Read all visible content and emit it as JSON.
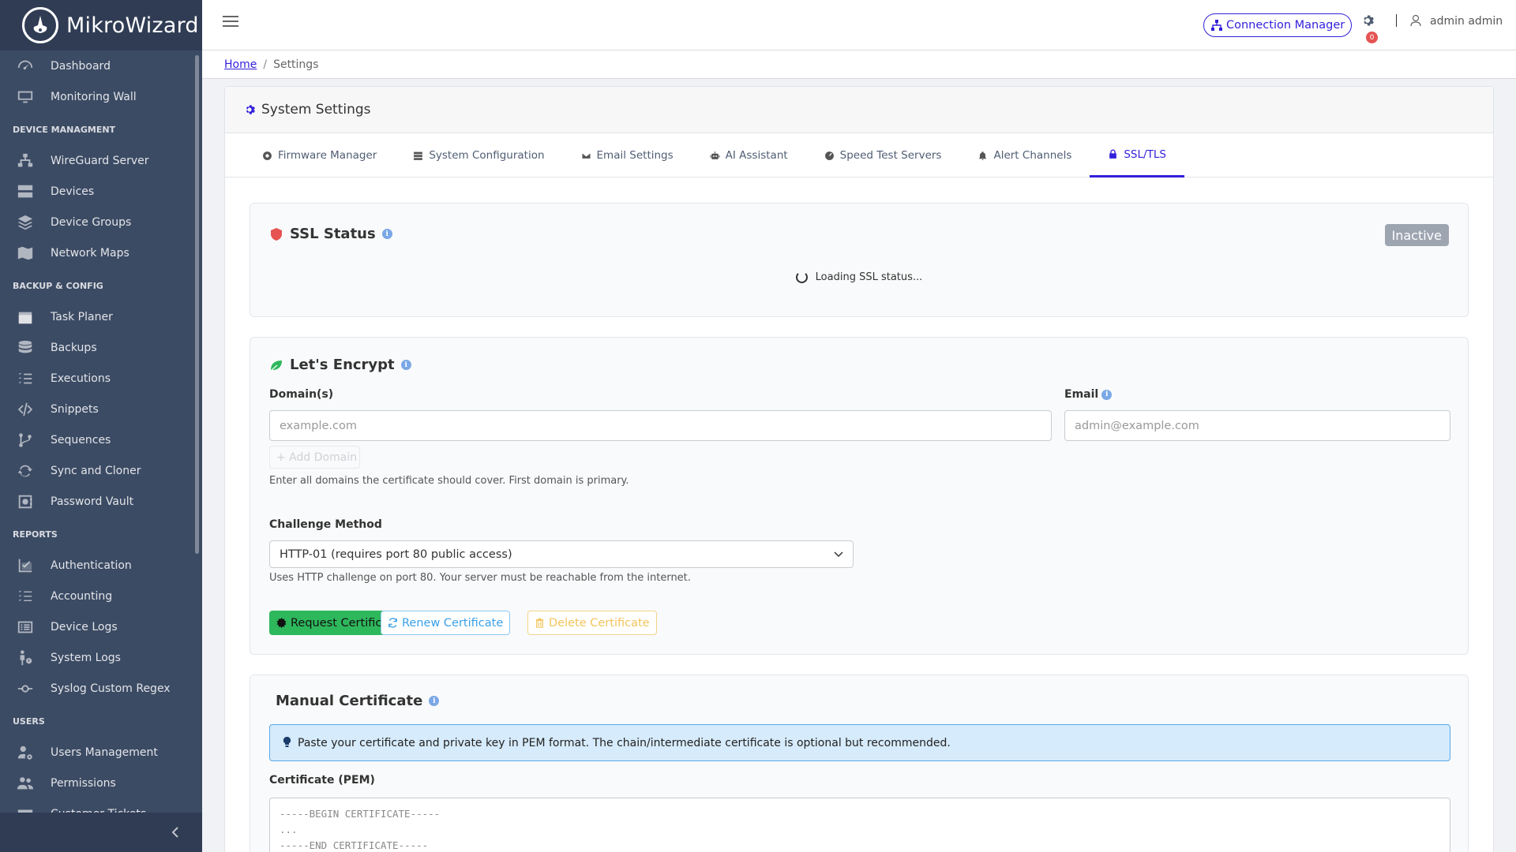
{
  "brand": {
    "name": "MikroWizard"
  },
  "sidebar": {
    "items": [
      {
        "type": "item",
        "label": "Dashboard",
        "icon": "speedometer-icon"
      },
      {
        "type": "item",
        "label": "Monitoring Wall",
        "icon": "monitor-icon"
      },
      {
        "type": "title",
        "label": "DEVICE MANAGMENT"
      },
      {
        "type": "item",
        "label": "WireGuard Server",
        "icon": "network-icon"
      },
      {
        "type": "item",
        "label": "Devices",
        "icon": "server-icon"
      },
      {
        "type": "item",
        "label": "Device Groups",
        "icon": "layers-icon"
      },
      {
        "type": "item",
        "label": "Network Maps",
        "icon": "map-icon"
      },
      {
        "type": "title",
        "label": "BACKUP & CONFIG"
      },
      {
        "type": "item",
        "label": "Task Planer",
        "icon": "calendar-icon"
      },
      {
        "type": "item",
        "label": "Backups",
        "icon": "database-icon"
      },
      {
        "type": "item",
        "label": "Executions",
        "icon": "list-check-icon"
      },
      {
        "type": "item",
        "label": "Snippets",
        "icon": "code-icon"
      },
      {
        "type": "item",
        "label": "Sequences",
        "icon": "branch-icon"
      },
      {
        "type": "item",
        "label": "Sync and Cloner",
        "icon": "sync-icon"
      },
      {
        "type": "item",
        "label": "Password Vault",
        "icon": "vault-icon"
      },
      {
        "type": "title",
        "label": "REPORTS"
      },
      {
        "type": "item",
        "label": "Authentication",
        "icon": "chart-check-icon"
      },
      {
        "type": "item",
        "label": "Accounting",
        "icon": "list-icon"
      },
      {
        "type": "item",
        "label": "Device Logs",
        "icon": "list-rich-icon"
      },
      {
        "type": "item",
        "label": "System Logs",
        "icon": "person-question-icon"
      },
      {
        "type": "item",
        "label": "Syslog Custom Regex",
        "icon": "commit-icon"
      },
      {
        "type": "title",
        "label": "USERS"
      },
      {
        "type": "item",
        "label": "Users Management",
        "icon": "user-gear-icon"
      },
      {
        "type": "item",
        "label": "Permissions",
        "icon": "people-icon"
      },
      {
        "type": "item",
        "label": "Customer Tickets",
        "icon": "ticket-icon"
      }
    ]
  },
  "header": {
    "connection_manager": "Connection Manager",
    "notification_count": "0",
    "user_name": "admin admin"
  },
  "breadcrumb": {
    "home": "Home",
    "current": "Settings"
  },
  "card": {
    "title": "System Settings"
  },
  "tabs": [
    {
      "label": "Firmware Manager",
      "icon": "firmware-icon"
    },
    {
      "label": "System Configuration",
      "icon": "config-icon"
    },
    {
      "label": "Email Settings",
      "icon": "envelope-icon"
    },
    {
      "label": "AI Assistant",
      "icon": "robot-icon"
    },
    {
      "label": "Speed Test Servers",
      "icon": "gauge-icon"
    },
    {
      "label": "Alert Channels",
      "icon": "bell-icon"
    },
    {
      "label": "SSL/TLS",
      "icon": "lock-icon",
      "active": true
    }
  ],
  "ssl_status": {
    "title": "SSL Status",
    "badge": "Inactive",
    "loading": "Loading SSL status..."
  },
  "lets_encrypt": {
    "title": "Let's Encrypt",
    "domains_label": "Domain(s)",
    "domains_placeholder": "example.com",
    "email_label": "Email",
    "email_placeholder": "admin@example.com",
    "add_domain": "+ Add Domain",
    "domains_help": "Enter all domains the certificate should cover. First domain is primary.",
    "challenge_label": "Challenge Method",
    "challenge_value": "HTTP-01 (requires port 80 public access)",
    "challenge_help": "Uses HTTP challenge on port 80. Your server must be reachable from the internet.",
    "request_btn": "Request Certificate",
    "renew_btn": "Renew Certificate",
    "delete_btn": "Delete Certificate"
  },
  "manual": {
    "title": "Manual Certificate",
    "info": "Paste your certificate and private key in PEM format. The chain/intermediate certificate is optional but recommended.",
    "cert_label": "Certificate (PEM)",
    "cert_placeholder": "-----BEGIN CERTIFICATE-----\n...\n-----END CERTIFICATE-----"
  },
  "colors": {
    "sidebar_bg": "#3c4b64",
    "primary": "#321fdb",
    "success": "#2eb85c",
    "danger": "#e55353",
    "info": "#39a0e8",
    "warning": "#f2c45a"
  }
}
